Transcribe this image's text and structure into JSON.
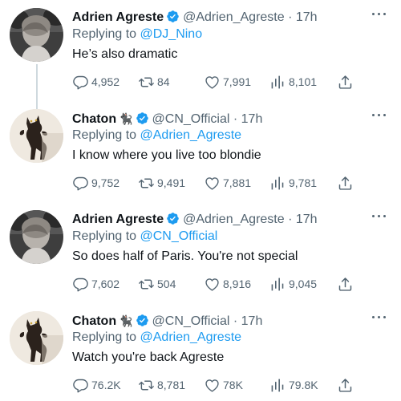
{
  "tweets": [
    {
      "name": "Adrien Agreste",
      "emoji": "",
      "handle": "@Adrien_Agreste",
      "dot": "·",
      "time": "17h",
      "replying_label": "Replying to",
      "replying_to": "@DJ_Nino",
      "text": "He’s also dramatic",
      "replies": "4,952",
      "retweets": "84",
      "likes": "7,991",
      "views": "8,101",
      "avatar": "portrait-grayscale"
    },
    {
      "name": "Chaton",
      "emoji": "🐈‍⬛",
      "handle": "@CN_Official",
      "dot": "·",
      "time": "17h",
      "replying_label": "Replying to",
      "replying_to": "@Adrien_Agreste",
      "text": "I know where you live too blondie",
      "replies": "9,752",
      "retweets": "9,491",
      "likes": "7,881",
      "views": "9,781",
      "avatar": "black-cat"
    },
    {
      "name": "Adrien Agreste",
      "emoji": "",
      "handle": "@Adrien_Agreste",
      "dot": "·",
      "time": "17h",
      "replying_label": "Replying to",
      "replying_to": "@CN_Official",
      "text": "So does half of Paris. You're not special",
      "replies": "7,602",
      "retweets": "504",
      "likes": "8,916",
      "views": "9,045",
      "avatar": "portrait-grayscale"
    },
    {
      "name": "Chaton",
      "emoji": "🐈‍⬛",
      "handle": "@CN_Official",
      "dot": "·",
      "time": "17h",
      "replying_label": "Replying to",
      "replying_to": "@Adrien_Agreste",
      "text": "Watch you're back Agreste",
      "replies": "76.2K",
      "retweets": "8,781",
      "likes": "78K",
      "views": "79.8K",
      "avatar": "black-cat"
    }
  ],
  "colors": {
    "text": "#0f1419",
    "muted": "#536471",
    "link": "#1d9bf0",
    "verified": "#1d9bf0",
    "thread_line": "#cfd9de"
  },
  "icons": {
    "reply": "reply-icon",
    "retweet": "retweet-icon",
    "like": "heart-icon",
    "views": "views-icon",
    "share": "share-icon",
    "more": "more-icon",
    "verified": "verified-badge-icon"
  }
}
